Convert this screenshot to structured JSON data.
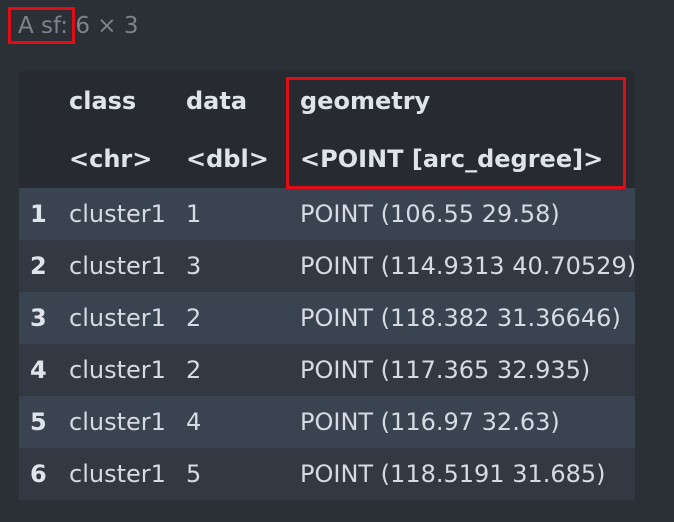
{
  "caption": "A sf: 6 × 3",
  "columns": [
    {
      "name": "class",
      "type": "<chr>"
    },
    {
      "name": "data",
      "type": "<dbl>"
    },
    {
      "name": "geometry",
      "type": "<POINT [arc_degree]>"
    }
  ],
  "rows": [
    {
      "index": "1",
      "class": "cluster1",
      "data": "1",
      "geometry": "POINT (106.55 29.58)"
    },
    {
      "index": "2",
      "class": "cluster1",
      "data": "3",
      "geometry": "POINT (114.9313 40.70529)"
    },
    {
      "index": "3",
      "class": "cluster1",
      "data": "2",
      "geometry": "POINT (118.382 31.36646)"
    },
    {
      "index": "4",
      "class": "cluster1",
      "data": "2",
      "geometry": "POINT (117.365 32.935)"
    },
    {
      "index": "5",
      "class": "cluster1",
      "data": "4",
      "geometry": "POINT (116.97 32.63)"
    },
    {
      "index": "6",
      "class": "cluster1",
      "data": "5",
      "geometry": "POINT (118.5191 31.685)"
    }
  ],
  "colors": {
    "background": "#2b2f36",
    "header_background": "#272b31",
    "row_odd": "#3a4350",
    "row_even": "#333943",
    "highlight_box": "#e00d17",
    "caption_text": "#7d838d"
  }
}
